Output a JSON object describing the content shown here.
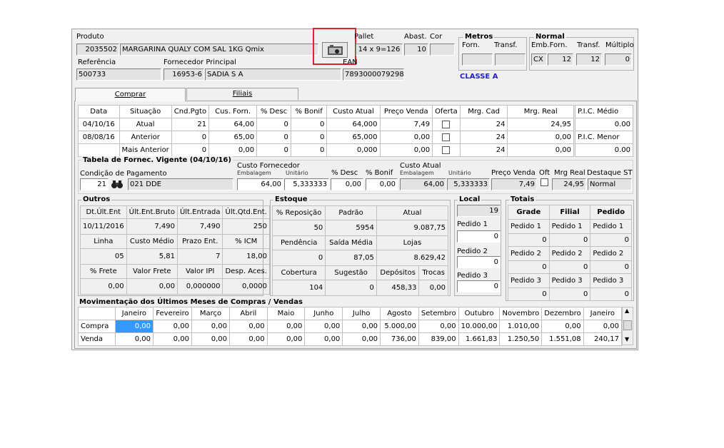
{
  "produto": {
    "label": "Produto",
    "code": "2035502",
    "name": "MARGARINA QUALY COM SAL 1KG Qmix"
  },
  "pallet": {
    "label": "Pallet",
    "value": "14 x 9=126"
  },
  "abast": {
    "label": "Abast.",
    "value": "10"
  },
  "cor": {
    "label": "Cor",
    "value": ""
  },
  "metros": {
    "title": "Metros",
    "forn_label": "Forn.",
    "transf_label": "Transf.",
    "forn": "",
    "transf": ""
  },
  "normal": {
    "title": "Normal",
    "emb_label": "Emb.Forn.",
    "transf_label": "Transf.",
    "mult_label": "Múltiplo",
    "emb_unit": "CX",
    "emb": "12",
    "transf": "12",
    "mult": "0"
  },
  "classe": "CLASSE A",
  "referencia": {
    "label": "Referência",
    "value": "500733"
  },
  "fornecedor": {
    "label": "Fornecedor Principal",
    "code": "16953-6",
    "name": "SADIA S A"
  },
  "ean": {
    "label": "EAN",
    "value": "7893000079298"
  },
  "tabs": [
    {
      "label": "Comprar"
    },
    {
      "label": "Filiais"
    }
  ],
  "hist": {
    "headers": [
      "Data",
      "Situação",
      "Cnd.Pgto",
      "Cus. Forn.",
      "% Desc",
      "% Bonif",
      "Custo Atual",
      "Preço Venda",
      "Oferta",
      "Mrg. Cad",
      "Mrg. Real"
    ],
    "rows": [
      [
        "04/10/16",
        "Atual",
        "21",
        "64,00",
        "0",
        "0",
        "64,000",
        "7,49",
        "",
        "24",
        "24,95"
      ],
      [
        "08/08/16",
        "Anterior",
        "0",
        "65,00",
        "0",
        "0",
        "65,000",
        "0,00",
        "",
        "24",
        "0,00"
      ],
      [
        "",
        "Mais Anterior",
        "0",
        "0,00",
        "0",
        "0",
        "0,000",
        "0,00",
        "",
        "24",
        "0,00"
      ]
    ]
  },
  "pic": {
    "medio_label": "P.I.C. Médio",
    "medio": "0.00",
    "menor_label": "P.I.C. Menor",
    "menor": "0.00"
  },
  "tabela": {
    "title": "Tabela de Fornec. Vigente (04/10/16)",
    "cond_label": "Condição de Pagamento",
    "cond_code": "21",
    "cond_name": "021 DDE",
    "custo_forn_label": "Custo Fornecedor",
    "emb_label": "Embalagem",
    "unit_label": "Unitário",
    "emb": "64,00",
    "unit": "5,333333",
    "desc_label": "% Desc",
    "desc": "0,00",
    "bonif_label": "% Bonif",
    "bonif": "0,00",
    "custo_atual_label": "Custo Atual",
    "ca_emb_label": "Embalagem",
    "ca_unit_label": "Unitário",
    "ca_emb": "64,00",
    "ca_unit": "5,333333",
    "pv_label": "Preço Venda",
    "pv": "7,49",
    "oft_label": "Oft",
    "mrg_label": "Mrg Real",
    "mrg": "24,95",
    "dest_label": "Destaque ST",
    "dest": "Normal"
  },
  "outros": {
    "title": "Outros",
    "rows": [
      [
        "Dt.Últ.Ent",
        "Últ.Ent.Bruto",
        "Últ.Entrada",
        "Últ.Qtd.Ent."
      ],
      [
        "10/11/2016",
        "7,490",
        "7,490",
        "250"
      ],
      [
        "Linha",
        "Custo Médio",
        "Prazo Ent.",
        "% ICM"
      ],
      [
        "05",
        "5,81",
        "7",
        "18,00"
      ],
      [
        "% Frete",
        "Valor Frete",
        "Valor IPI",
        "Desp. Aces."
      ],
      [
        "0,00",
        "0,00",
        "0,000000",
        "0,0000"
      ]
    ]
  },
  "estoque": {
    "title": "Estoque",
    "rows": [
      [
        "% Reposição",
        "Padrão",
        "Atual",
        ""
      ],
      [
        "50",
        "5954",
        "9.087,75",
        ""
      ],
      [
        "Pendência",
        "Saída Média",
        "Lojas",
        ""
      ],
      [
        "0",
        "87,05",
        "8.629,42",
        ""
      ],
      [
        "Cobertura",
        "Sugestão",
        "Depósitos",
        "Trocas"
      ],
      [
        "104",
        "0",
        "458,33",
        "0,00"
      ]
    ]
  },
  "local": {
    "title": "Local",
    "value": "19",
    "p1_label": "Pedido 1",
    "p1": "0",
    "p2_label": "Pedido 2",
    "p2": "0",
    "p3_label": "Pedido 3",
    "p3": "0"
  },
  "totais": {
    "title": "Totais",
    "headers": [
      "Grade",
      "Filial",
      "Pedido"
    ],
    "rows": [
      [
        "Pedido 1",
        "Pedido 1",
        "Pedido 1"
      ],
      [
        "0",
        "0",
        "0"
      ],
      [
        "Pedido 2",
        "Pedido 2",
        "Pedido 2"
      ],
      [
        "0",
        "0",
        "0"
      ],
      [
        "Pedido 3",
        "Pedido 3",
        "Pedido 3"
      ],
      [
        "0",
        "0",
        "0"
      ]
    ]
  },
  "mov": {
    "title": "Movimentação dos Últimos Meses de Compras / Vendas",
    "headers": [
      "",
      "Janeiro",
      "Fevereiro",
      "Março",
      "Abril",
      "Maio",
      "Junho",
      "Julho",
      "Agosto",
      "Setembro",
      "Outubro",
      "Novembro",
      "Dezembro",
      "Janeiro"
    ],
    "rows": [
      [
        "Compra",
        "0,00",
        "0,00",
        "0,00",
        "0,00",
        "0,00",
        "0,00",
        "0,00",
        "5.000,00",
        "0,00",
        "10.000,00",
        "1.010,00",
        "0,00",
        "0,00"
      ],
      [
        "Venda",
        "0,00",
        "0,00",
        "0,00",
        "0,00",
        "0,00",
        "0,00",
        "0,00",
        "736,00",
        "839,00",
        "1.661,83",
        "1.250,50",
        "1.551,08",
        "240,17"
      ]
    ]
  },
  "colors": {
    "highlight": "#d9262c",
    "classe": "#1f1fc8",
    "selected_cell": "#3399ff"
  }
}
